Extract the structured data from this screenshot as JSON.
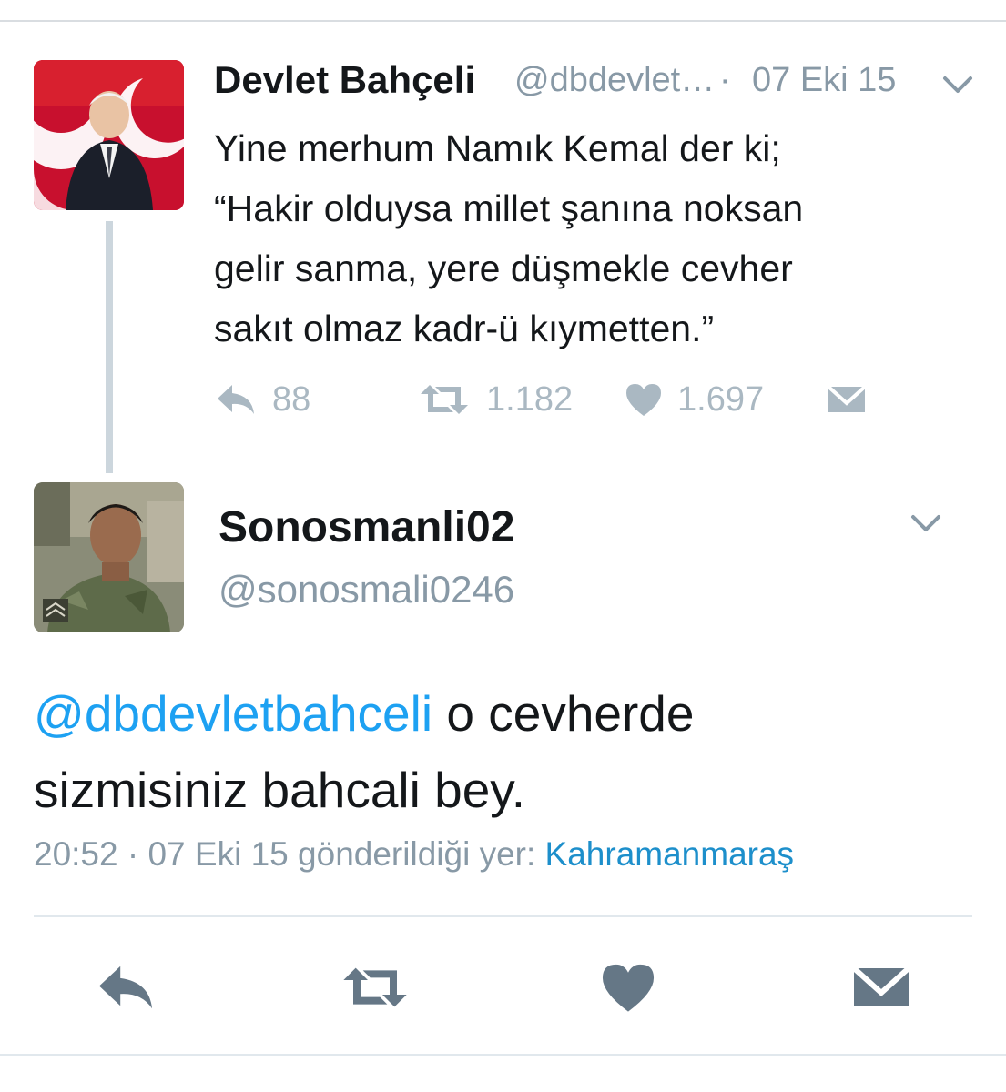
{
  "parent_tweet": {
    "name": "Devlet Bahçeli",
    "handle": "@dbdevlet…",
    "separator": "·",
    "date": "07 Eki 15",
    "text_lines": [
      "Yine merhum Namık Kemal der ki;",
      "“Hakir olduysa millet şanına noksan",
      "gelir sanma, yere düşmekle cevher",
      "sakıt olmaz kadr-ü kıymetten.”"
    ],
    "actions": {
      "reply_count": "88",
      "retweet_count": "1.182",
      "like_count": "1.697"
    }
  },
  "reply_tweet": {
    "name": "Sonosmanli02",
    "handle": "@sonosmali0246",
    "mention": "@dbdevletbahceli",
    "text_rest_line1": " o cevherde",
    "text_line2": "sizmisiniz bahcali bey.",
    "time": "20:52",
    "separator": "·",
    "date": "07 Eki 15",
    "sent_from_label": "gönderildiği yer:",
    "location": "Kahramanmaraş"
  },
  "icons": {
    "reply": "reply-icon",
    "retweet": "retweet-icon",
    "like": "heart-icon",
    "message": "envelope-icon",
    "more": "chevron-down-icon"
  },
  "colors": {
    "link": "#1da1f2",
    "muted": "#8899a6",
    "action_icon": "#aab8c2",
    "bottom_action_icon": "#657786"
  }
}
